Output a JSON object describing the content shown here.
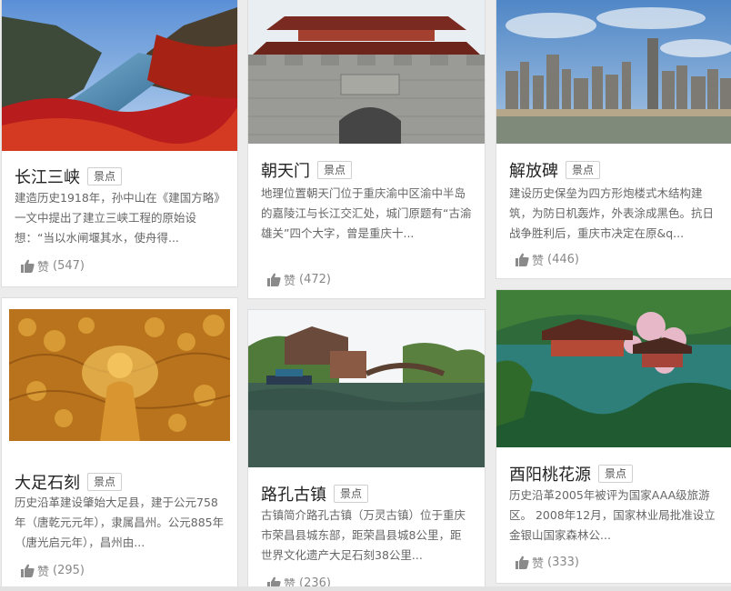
{
  "cards": [
    {
      "title": "长江三峡",
      "tag": "景点",
      "desc": "建造历史1918年，孙中山在《建国方略》一文中提出了建立三峡工程的原始设想：“当以水闸堰其水，使舟得...",
      "like_label": "赞",
      "like_count": "(547)",
      "image_icon": "gorge-photo"
    },
    {
      "title": "朝天门",
      "tag": "景点",
      "desc": "地理位置朝天门位于重庆渝中区渝中半岛的嘉陵江与长江交汇处，城门原题有“古渝雄关”四个大字，曾是重庆十...",
      "like_label": "赞",
      "like_count": "(472)",
      "image_icon": "gate-tower-photo"
    },
    {
      "title": "解放碑",
      "tag": "景点",
      "desc": "建设历史保垒为四方形炮楼式木结构建筑，为防日机轰炸，外表涂成黑色。抗日战争胜利后，重庆市决定在原&q...",
      "like_label": "赞",
      "like_count": "(446)",
      "image_icon": "skyline-photo"
    },
    {
      "title": "大足石刻",
      "tag": "景点",
      "desc": "历史沿革建设肇始大足县，建于公元758年（唐乾元元年），隶属昌州。公元885年（唐光启元年），昌州由...",
      "like_label": "赞",
      "like_count": "(295)",
      "image_icon": "carving-photo"
    },
    {
      "title": "路孔古镇",
      "tag": "景点",
      "desc": "古镇简介路孔古镇（万灵古镇）位于重庆市荣昌县城东部，距荣昌县城8公里，距世界文化遗产大足石刻38公里...",
      "like_label": "赞",
      "like_count": "(236)",
      "image_icon": "old-town-photo"
    },
    {
      "title": "酉阳桃花源",
      "tag": "景点",
      "desc": "历史沿革2005年被评为国家AAA级旅游区。 2008年12月，国家林业局批准设立金银山国家森林公...",
      "like_label": "赞",
      "like_count": "(333)",
      "image_icon": "peach-garden-photo"
    }
  ],
  "colors": {
    "accent_text": "#222222",
    "muted_text": "#666666",
    "like_text": "#888888",
    "tag_border": "#cfcfcf"
  }
}
